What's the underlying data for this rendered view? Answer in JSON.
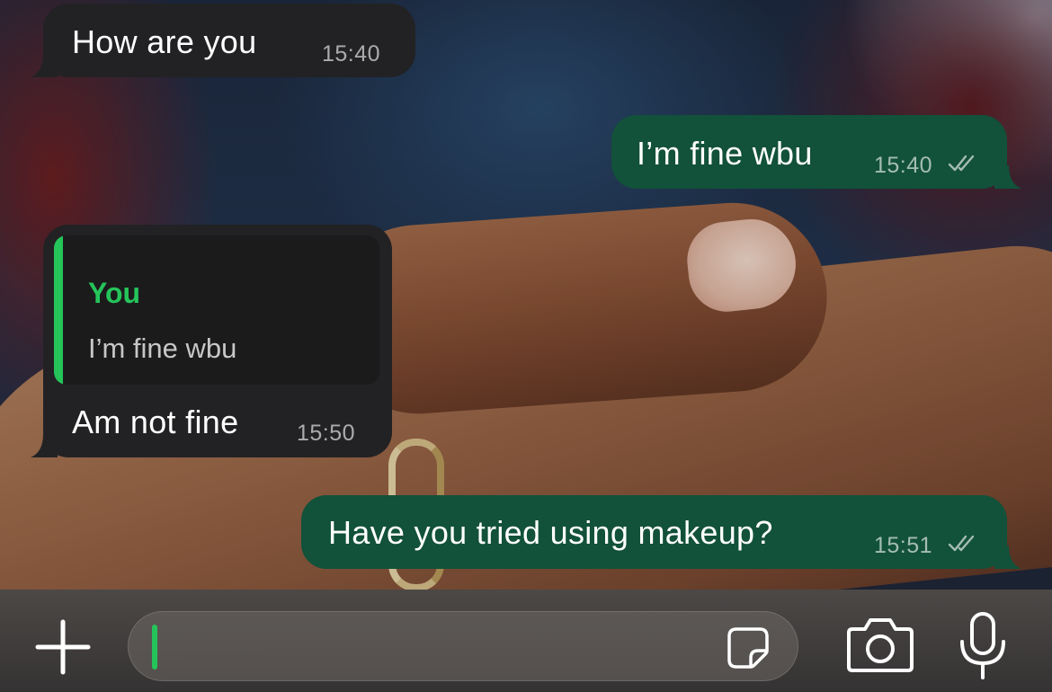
{
  "messages": [
    {
      "direction": "incoming",
      "text": "How  are you",
      "time": "15:40"
    },
    {
      "direction": "outgoing",
      "text": "I’m fine wbu",
      "time": "15:40",
      "status": "read"
    },
    {
      "direction": "incoming",
      "reply_to": {
        "author": "You",
        "text": "I’m fine wbu"
      },
      "text": "Am not fine",
      "time": "15:50"
    },
    {
      "direction": "outgoing",
      "text": "Have you tried using makeup?",
      "time": "15:51",
      "status": "read"
    }
  ],
  "composer": {
    "text_value": "",
    "icons": [
      "plus-icon",
      "sticker-icon",
      "camera-icon",
      "microphone-icon"
    ]
  },
  "colors": {
    "incoming_bubble": "#222224",
    "outgoing_bubble": "#12513a",
    "accent_green": "#25c45a",
    "timestamp": "rgba(255,255,255,0.62)"
  }
}
